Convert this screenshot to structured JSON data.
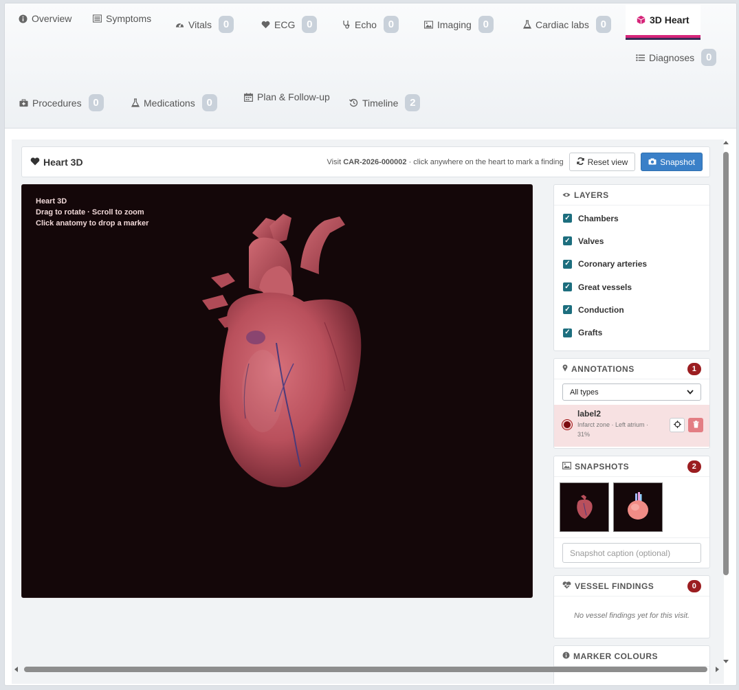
{
  "tabs": [
    {
      "label": "Overview",
      "icon": "info-circle-icon",
      "count": null
    },
    {
      "label": "Symptoms",
      "icon": "list-card-icon",
      "count": null
    },
    {
      "label": "Vitals",
      "icon": "gauge-icon",
      "count": "0"
    },
    {
      "label": "ECG",
      "icon": "heart-icon",
      "count": "0"
    },
    {
      "label": "Echo",
      "icon": "stethoscope-icon",
      "count": "0"
    },
    {
      "label": "Imaging",
      "icon": "image-icon",
      "count": "0"
    },
    {
      "label": "Cardiac labs",
      "icon": "flask-icon",
      "count": "0"
    },
    {
      "label": "3D Heart",
      "icon": "cube-icon",
      "count": null,
      "active": true
    },
    {
      "label": "Diagnoses",
      "icon": "list-icon",
      "count": "0"
    },
    {
      "label": "Procedures",
      "icon": "medkit-icon",
      "count": "0"
    },
    {
      "label": "Medications",
      "icon": "flask-icon",
      "count": "0"
    },
    {
      "label": "Plan & Follow-up",
      "icon": "calendar-icon",
      "count": null
    },
    {
      "label": "Timeline",
      "icon": "history-icon",
      "count": "2"
    }
  ],
  "header": {
    "title": "Heart 3D",
    "visit_prefix": "Visit ",
    "visit_id": "CAR-2026-000002",
    "visit_hint": " · click anywhere on the heart to mark a finding",
    "reset_label": "Reset view",
    "snapshot_label": "Snapshot"
  },
  "viewer": {
    "hint_title": "Heart 3D",
    "hint_line1": "Drag to rotate · Scroll to zoom",
    "hint_line2": "Click anatomy to drop a marker"
  },
  "layers": {
    "title": "LAYERS",
    "items": [
      "Chambers",
      "Valves",
      "Coronary arteries",
      "Great vessels",
      "Conduction",
      "Grafts"
    ]
  },
  "annotations": {
    "title": "ANNOTATIONS",
    "count": "1",
    "filter_value": "All types",
    "items": [
      {
        "label": "label2",
        "type": "Infarct zone",
        "location": "Left atrium",
        "value": "31%"
      }
    ]
  },
  "snapshots": {
    "title": "SNAPSHOTS",
    "count": "2",
    "caption_placeholder": "Snapshot caption (optional)"
  },
  "vessel_findings": {
    "title": "VESSEL FINDINGS",
    "count": "0",
    "empty": "No vessel findings yet for this visit."
  },
  "marker_colours": {
    "title": "MARKER COLOURS"
  },
  "colors": {
    "accent_pink": "#d6267a",
    "primary_blue": "#3a80c8",
    "badge_red": "#9b1d20",
    "checkbox_teal": "#1d6e7e",
    "viewer_bg": "#140709"
  }
}
